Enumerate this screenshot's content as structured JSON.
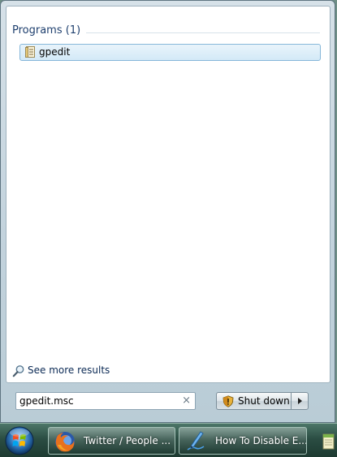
{
  "results": {
    "group_header": "Programs (1)",
    "items": [
      {
        "label": "gpedit",
        "icon": "document-icon"
      }
    ],
    "see_more_label": "See more results"
  },
  "search": {
    "value": "gpedit.msc",
    "clear_glyph": "×"
  },
  "shutdown": {
    "label": "Shut down"
  },
  "taskbar": {
    "buttons": [
      {
        "label": "Twitter / People ...",
        "icon": "firefox-icon"
      },
      {
        "label": "How To Disable E...",
        "icon": "writer-pen-icon"
      }
    ]
  },
  "colors": {
    "group_header_text": "#1e3f6e",
    "selection_border": "#86b7d9",
    "taskbar_base": "#2b4d43"
  }
}
